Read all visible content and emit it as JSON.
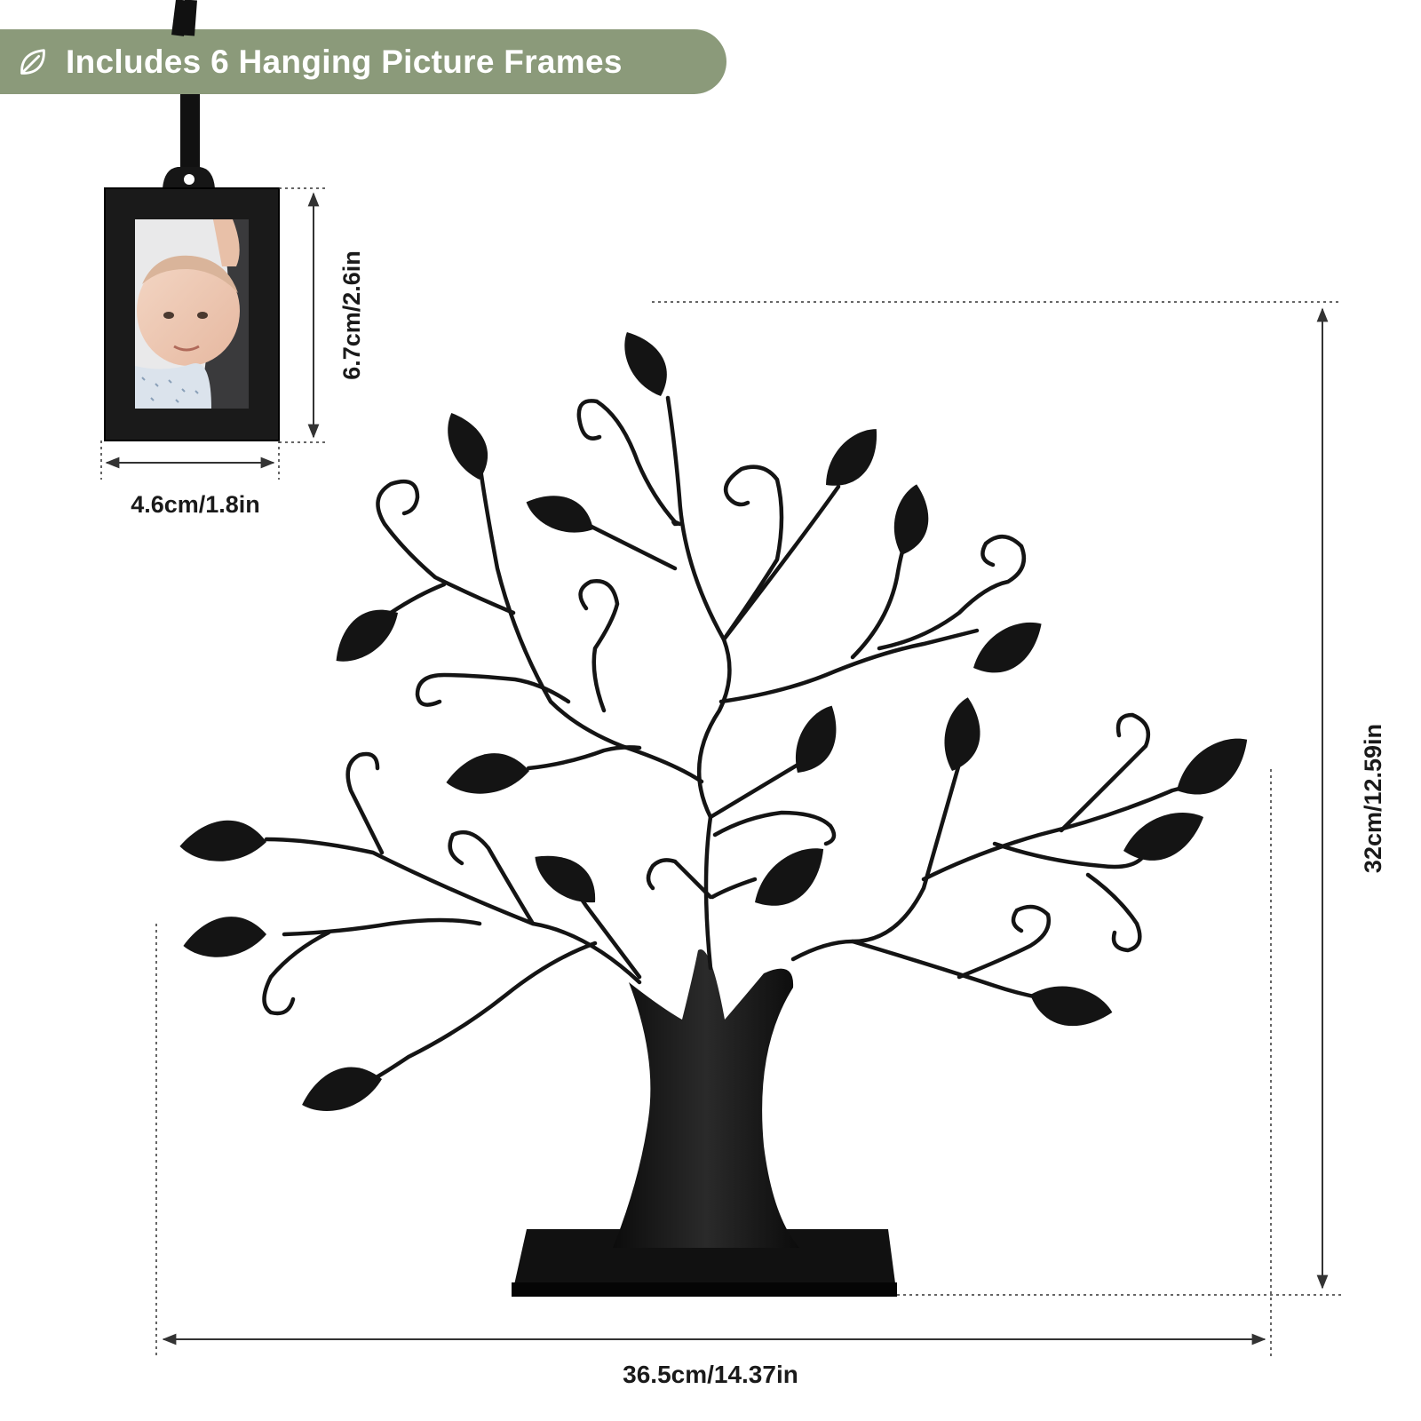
{
  "banner": {
    "text": "Includes 6 Hanging Picture Frames",
    "icon": "leaf-icon",
    "color": "#8b9a7a"
  },
  "frame": {
    "width_label": "4.6cm/1.8in",
    "height_label": "6.7cm/2.6in"
  },
  "tree": {
    "width_label": "36.5cm/14.37in",
    "height_label": "32cm/12.59in"
  },
  "colors": {
    "metal": "#141414",
    "dimension_line": "#333333"
  }
}
